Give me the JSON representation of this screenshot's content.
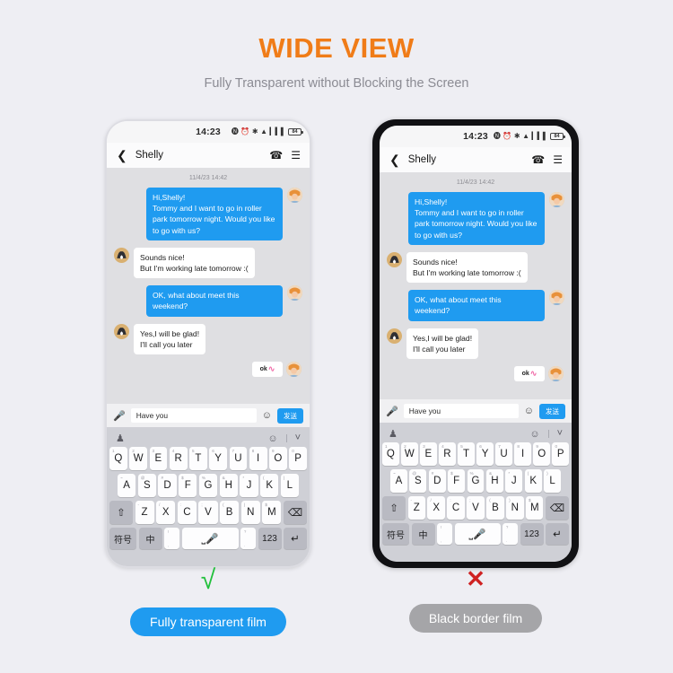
{
  "header": {
    "title": "WIDE VIEW",
    "subtitle": "Fully Transparent without Blocking the Screen"
  },
  "colors": {
    "accent_orange": "#f07c18",
    "accent_blue": "#1f9bf0",
    "check_green": "#22c03c",
    "cross_red": "#cf2222",
    "gray_pill": "#a5a5a8",
    "page_bg": "#eeeef3",
    "bezel_black": "#111114",
    "bezel_thin": "#dcdce2"
  },
  "phone": {
    "status_bar": {
      "time": "14:23",
      "battery_level": "84",
      "icons": [
        "nfc-icon",
        "alarm-icon",
        "bluetooth-icon",
        "wifi-icon",
        "signal-icon",
        "battery-icon"
      ]
    },
    "chat_nav": {
      "back_icon": "chevron-left-icon",
      "contact_name": "Shelly",
      "call_icon": "phone-icon",
      "menu_icon": "hamburger-menu-icon"
    },
    "conversation": {
      "timestamp": "11/4/23 14:42",
      "messages": [
        {
          "side": "out",
          "text": "Hi,Shelly!\nTommy and I want to go in roller park tomorrow night. Would you like to go with us?"
        },
        {
          "side": "in",
          "text": "Sounds nice!\nBut I'm working late tomorrow :("
        },
        {
          "side": "out",
          "text": "OK, what about meet this weekend?"
        },
        {
          "side": "in",
          "text": "Yes,I will be glad!\nI'll call you later"
        }
      ],
      "sticker": {
        "label": "ok",
        "name": "ok-sticker"
      }
    },
    "input_bar": {
      "mic_icon": "microphone-icon",
      "value": "Have you",
      "placeholder": "Have you",
      "emoji_icon": "emoji-smiley-icon",
      "send_label": "发送"
    },
    "keyboard": {
      "toolbar": {
        "left_icon": "sticker-pack-icon",
        "emoji_icon": "emoji-smiley-icon",
        "collapse_icon": "chevron-down-icon"
      },
      "row1": [
        {
          "key": "Q",
          "sup": "1"
        },
        {
          "key": "W",
          "sup": "2"
        },
        {
          "key": "E",
          "sup": "3"
        },
        {
          "key": "R",
          "sup": "4"
        },
        {
          "key": "T",
          "sup": "5"
        },
        {
          "key": "Y",
          "sup": "6"
        },
        {
          "key": "U",
          "sup": "7"
        },
        {
          "key": "I",
          "sup": "8"
        },
        {
          "key": "O",
          "sup": "9"
        },
        {
          "key": "P",
          "sup": "0"
        }
      ],
      "row2": [
        {
          "key": "A",
          "sup": "~"
        },
        {
          "key": "S",
          "sup": "@"
        },
        {
          "key": "D",
          "sup": "#"
        },
        {
          "key": "F",
          "sup": "$"
        },
        {
          "key": "G",
          "sup": "%"
        },
        {
          "key": "H",
          "sup": "&"
        },
        {
          "key": "J",
          "sup": "*"
        },
        {
          "key": "K",
          "sup": "("
        },
        {
          "key": "L",
          "sup": ")"
        }
      ],
      "row3": {
        "shift": "⇧",
        "keys": [
          {
            "key": "Z",
            "sup": "-"
          },
          {
            "key": "X",
            "sup": "/"
          },
          {
            "key": "C",
            "sup": ":"
          },
          {
            "key": "V",
            "sup": ";"
          },
          {
            "key": "B",
            "sup": "("
          },
          {
            "key": "N",
            "sup": ")"
          },
          {
            "key": "M",
            "sup": "$"
          }
        ],
        "delete": "⌫"
      },
      "row4": {
        "symbol": "符号",
        "language": "中",
        "comma_top": "!",
        "comma_bottom": ",",
        "space_icon": "microphone-icon",
        "period_top": "?",
        "period_bottom": ".",
        "numbers": "123",
        "enter": "↵"
      }
    }
  },
  "comparison": {
    "left": {
      "mark": "√",
      "mark_name": "check-mark",
      "label": "Fully transparent film"
    },
    "right": {
      "mark": "✕",
      "mark_name": "cross-mark",
      "label": "Black border film"
    }
  }
}
